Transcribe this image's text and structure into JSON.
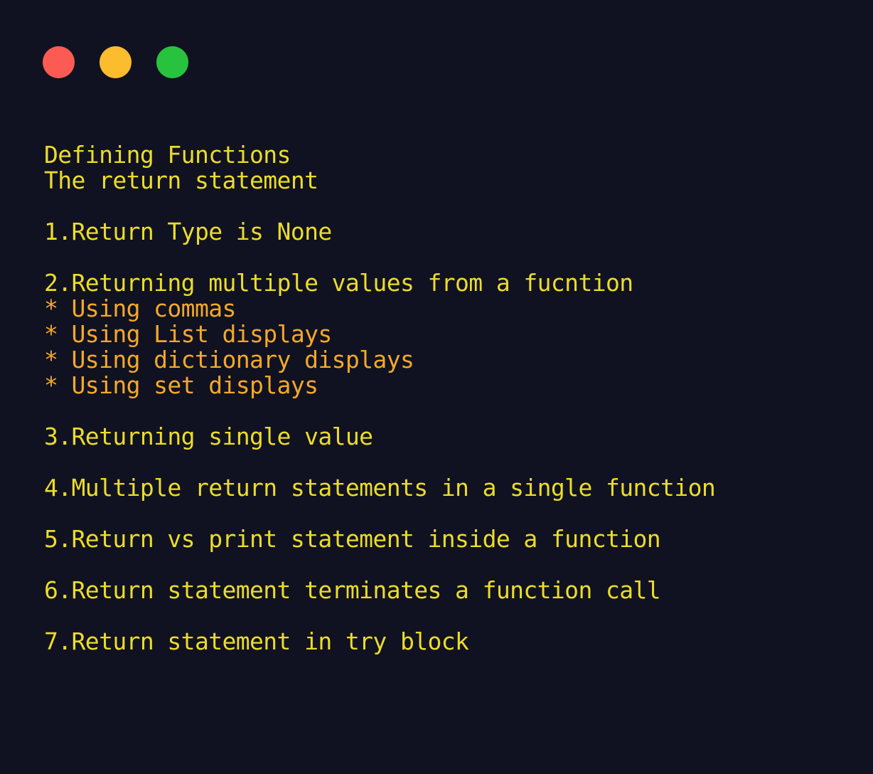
{
  "window": {
    "controls": [
      {
        "name": "close",
        "label": "Close",
        "color": "#fb5b53"
      },
      {
        "name": "minimize",
        "label": "Minimize",
        "color": "#fbbc2e"
      },
      {
        "name": "maximize",
        "label": "Maximize",
        "color": "#27c33e"
      }
    ]
  },
  "theme": {
    "background": "#101222",
    "primary_text": "#ecdc2a",
    "accent_text": "#f5a829"
  },
  "content": {
    "title_lines": [
      "Defining Functions",
      "The return statement"
    ],
    "lines": [
      {
        "text": "Defining Functions",
        "color": "primary"
      },
      {
        "text": "The return statement",
        "color": "primary"
      },
      {
        "text": "",
        "color": "primary"
      },
      {
        "text": "1.Return Type is None",
        "color": "primary"
      },
      {
        "text": "",
        "color": "primary"
      },
      {
        "text": "2.Returning multiple values from a fucntion",
        "color": "primary"
      },
      {
        "text": "* Using commas",
        "color": "accent"
      },
      {
        "text": "* Using List displays",
        "color": "accent"
      },
      {
        "text": "* Using dictionary displays",
        "color": "accent"
      },
      {
        "text": "* Using set displays",
        "color": "accent"
      },
      {
        "text": "",
        "color": "primary"
      },
      {
        "text": "3.Returning single value",
        "color": "primary"
      },
      {
        "text": "",
        "color": "primary"
      },
      {
        "text": "4.Multiple return statements in a single function",
        "color": "primary"
      },
      {
        "text": "",
        "color": "primary"
      },
      {
        "text": "5.Return vs print statement inside a function",
        "color": "primary"
      },
      {
        "text": "",
        "color": "primary"
      },
      {
        "text": "6.Return statement terminates a function call",
        "color": "primary"
      },
      {
        "text": "",
        "color": "primary"
      },
      {
        "text": "7.Return statement in try block",
        "color": "primary"
      }
    ]
  }
}
